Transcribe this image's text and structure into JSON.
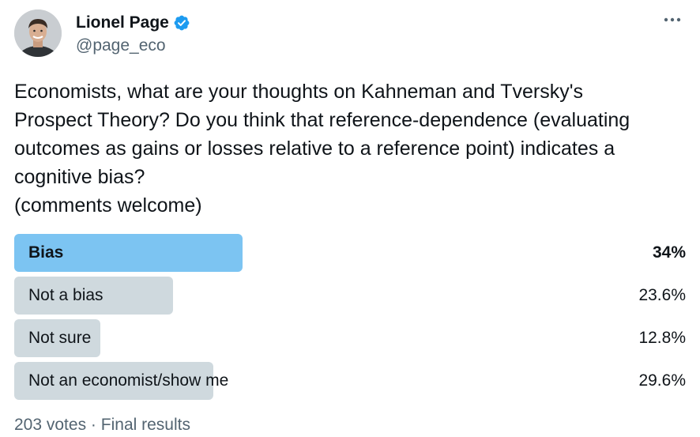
{
  "author": {
    "display_name": "Lionel Page",
    "handle": "@page_eco",
    "verified": true,
    "avatar_icon": "profile-photo"
  },
  "more_icon": "more-options-icon",
  "tweet": {
    "lines": [
      "Economists, what are your thoughts on Kahneman and Tversky's",
      "Prospect Theory? Do you think that reference-dependence (evaluating",
      "outcomes as gains or losses relative to a reference point) indicates a",
      "cognitive bias?",
      "(comments welcome)"
    ]
  },
  "poll": {
    "options": [
      {
        "label": "Bias",
        "percent_text": "34%",
        "percent": 34,
        "winner": true
      },
      {
        "label": "Not a bias",
        "percent_text": "23.6%",
        "percent": 23.6,
        "winner": false
      },
      {
        "label": "Not sure",
        "percent_text": "12.8%",
        "percent": 12.8,
        "winner": false
      },
      {
        "label": "Not an economist/show me",
        "percent_text": "29.6%",
        "percent": 29.6,
        "winner": false
      }
    ],
    "votes": "203 votes",
    "separator": "·",
    "status": "Final results"
  },
  "colors": {
    "winner_bar": "#7cc4f2",
    "other_bar": "#cfd9de",
    "verified_blue": "#1d9bf0",
    "secondary_text": "#536471"
  }
}
